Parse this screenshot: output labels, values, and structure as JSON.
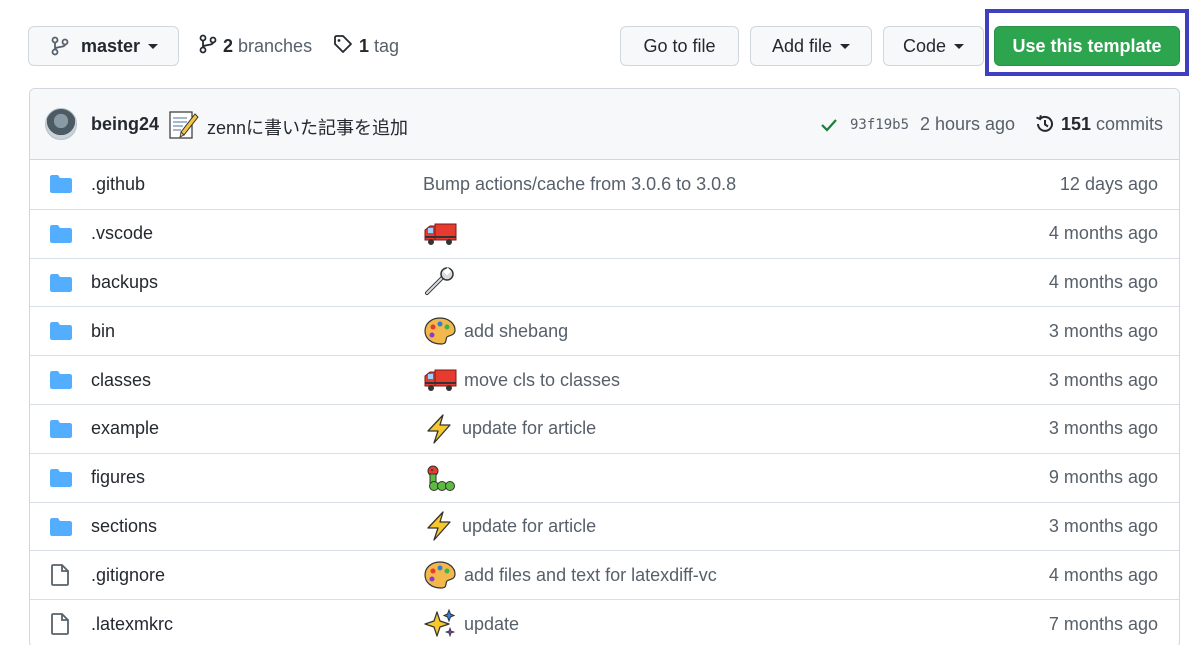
{
  "topbar": {
    "branch_label": "master",
    "branches_count": "2",
    "branches_label": "branches",
    "tags_count": "1",
    "tags_label": "tag",
    "go_to_file": "Go to file",
    "add_file": "Add file",
    "code": "Code",
    "use_template": "Use this template"
  },
  "commit": {
    "author": "being24",
    "message": "zennに書いた記事を追加",
    "sha": "93f19b5",
    "time": "2 hours ago",
    "commits_count": "151",
    "commits_label": "commits"
  },
  "files": [
    {
      "name": ".github",
      "type": "folder",
      "emoji": "",
      "message": "Bump actions/cache from 3.0.6 to 3.0.8",
      "age": "12 days ago"
    },
    {
      "name": ".vscode",
      "type": "folder",
      "emoji": "truck",
      "message": "",
      "age": "4 months ago"
    },
    {
      "name": "backups",
      "type": "folder",
      "emoji": "wrench",
      "message": "",
      "age": "4 months ago"
    },
    {
      "name": "bin",
      "type": "folder",
      "emoji": "palette",
      "message": "add shebang",
      "age": "3 months ago"
    },
    {
      "name": "classes",
      "type": "folder",
      "emoji": "truck",
      "message": "move cls to classes",
      "age": "3 months ago"
    },
    {
      "name": "example",
      "type": "folder",
      "emoji": "zap",
      "message": "update for article",
      "age": "3 months ago"
    },
    {
      "name": "figures",
      "type": "folder",
      "emoji": "caterpillar",
      "message": "",
      "age": "9 months ago"
    },
    {
      "name": "sections",
      "type": "folder",
      "emoji": "zap",
      "message": "update for article",
      "age": "3 months ago"
    },
    {
      "name": ".gitignore",
      "type": "file",
      "emoji": "palette",
      "message": "add files and text for latexdiff-vc",
      "age": "4 months ago"
    },
    {
      "name": ".latexmkrc",
      "type": "file",
      "emoji": "sparkles",
      "message": "update",
      "age": "7 months ago"
    }
  ],
  "colors": {
    "accent_green": "#2da44e",
    "highlight_box": "#3f3fbf",
    "folder_blue": "#54aeff"
  }
}
